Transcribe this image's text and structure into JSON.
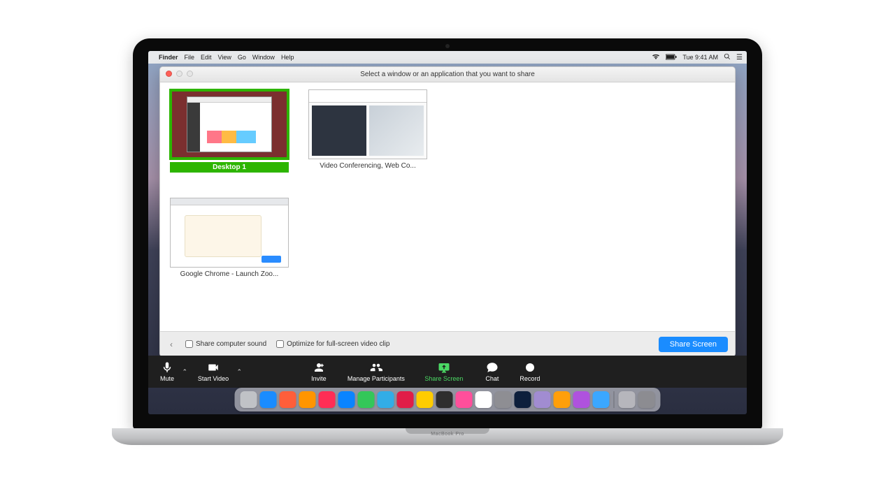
{
  "device_label": "MacBook Pro",
  "menubar": {
    "apple": "",
    "app": "Finder",
    "items": [
      "File",
      "Edit",
      "View",
      "Go",
      "Window",
      "Help"
    ],
    "time": "Tue 9:41 AM"
  },
  "share_window": {
    "title": "Select a window or an application that you want to share",
    "thumbs": [
      {
        "label": "Desktop 1",
        "selected": true,
        "kind": "desktop"
      },
      {
        "label": "Video Conferencing, Web Co...",
        "selected": false,
        "kind": "video"
      },
      {
        "label": "Google Chrome - Launch Zoo...",
        "selected": false,
        "kind": "chrome"
      }
    ],
    "options": {
      "back_glyph": "‹",
      "share_sound": "Share computer sound",
      "optimize_clip": "Optimize for full-screen video clip",
      "share_button": "Share Screen"
    }
  },
  "zoom_toolbar": {
    "mute": "Mute",
    "start_video": "Start Video",
    "invite": "Invite",
    "manage": "Manage Participants",
    "share": "Share Screen",
    "chat": "Chat",
    "record": "Record"
  },
  "dock_colors": [
    "#c0c2c6",
    "#1a8cff",
    "#ff5e3a",
    "#ff9500",
    "#ff2d55",
    "#0a84ff",
    "#34c759",
    "#32ade6",
    "#e11d48",
    "#ffcc00",
    "#2e2e2e",
    "#ff4f9b",
    "#ffffff",
    "#8e8e93",
    "#0d1f3c",
    "#a18cd1",
    "#ff9f0a",
    "#af52de",
    "#3ba7ff",
    "#b6b6bc",
    "#8c8c91"
  ]
}
